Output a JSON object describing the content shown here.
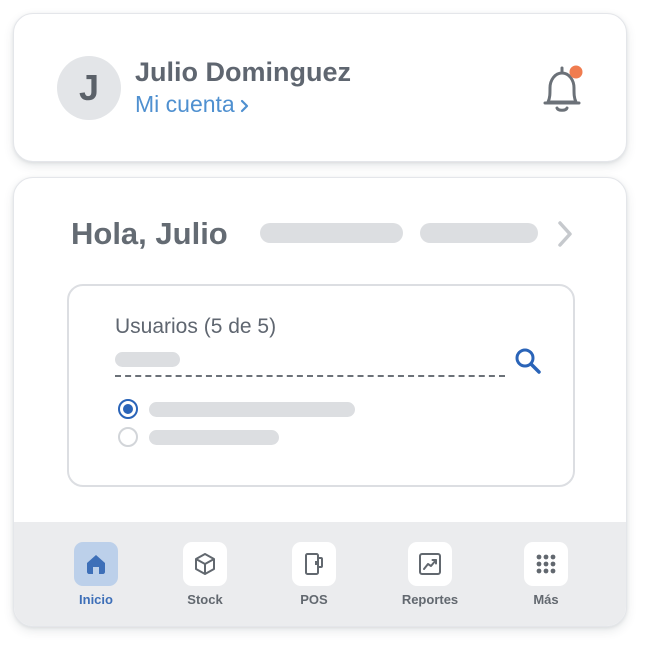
{
  "profile": {
    "avatar_initial": "J",
    "name": "Julio Dominguez",
    "account_link": "Mi cuenta",
    "notification_dot_color": "#f07c4f"
  },
  "main": {
    "greeting": "Hola, Julio",
    "users_panel": {
      "title": "Usuarios (5 de 5)",
      "options": [
        {
          "selected": true
        },
        {
          "selected": false
        }
      ]
    }
  },
  "nav": {
    "items": [
      {
        "label": "Inicio",
        "icon": "home-icon",
        "active": true
      },
      {
        "label": "Stock",
        "icon": "box-icon",
        "active": false
      },
      {
        "label": "POS",
        "icon": "pos-device-icon",
        "active": false
      },
      {
        "label": "Reportes",
        "icon": "chart-icon",
        "active": false
      },
      {
        "label": "Más",
        "icon": "grid-dots-icon",
        "active": false
      }
    ]
  },
  "colors": {
    "accent": "#4f90d0",
    "primary_blue": "#2a64b8",
    "active_tile": "#bcd0ea",
    "placeholder": "#dcdee1"
  }
}
